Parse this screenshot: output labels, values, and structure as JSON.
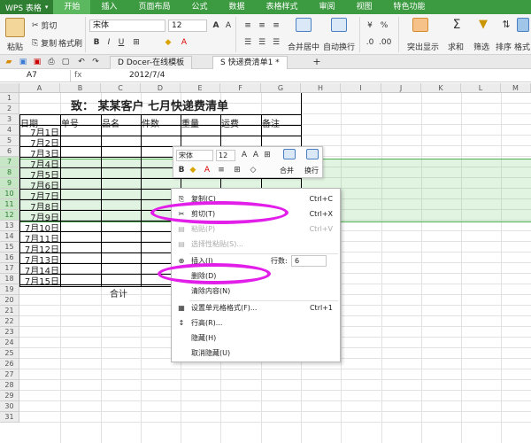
{
  "menubar": {
    "app": "WPS 表格",
    "items": [
      "开始",
      "插入",
      "页面布局",
      "公式",
      "数据",
      "表格样式",
      "审阅",
      "视图",
      "特色功能"
    ]
  },
  "ribbon": {
    "paste": "粘贴",
    "cut": "剪切",
    "copy": "复制",
    "format_painter": "格式刷",
    "font": "宋体",
    "size": "12",
    "merge": "合并居中",
    "wrap": "自动换行",
    "highlight": "突出显示",
    "sum": "求和",
    "filter": "筛选",
    "sort": "排序",
    "format": "格式"
  },
  "tabs": [
    "Docer-在线模板",
    "快递费清单1 *"
  ],
  "formula": {
    "cell": "A7",
    "fx": "fx",
    "value": "2012/7/4"
  },
  "columns": [
    "A",
    "B",
    "C",
    "D",
    "E",
    "F",
    "G",
    "H",
    "I",
    "J",
    "K",
    "L",
    "M"
  ],
  "rows": [
    "1",
    "2",
    "3",
    "4",
    "5",
    "6",
    "7",
    "8",
    "9",
    "10",
    "11",
    "12",
    "13",
    "14",
    "15",
    "16",
    "17",
    "18",
    "19",
    "20",
    "21",
    "22",
    "23",
    "24",
    "25",
    "26",
    "27",
    "28",
    "29",
    "30",
    "31"
  ],
  "sheet": {
    "title": "致：  某某客户   七月快递费清单",
    "headers": [
      "日期",
      "单号",
      "品名",
      "件数",
      "重量",
      "运费",
      "备注"
    ],
    "dates": [
      "7月1日",
      "7月2日",
      "7月3日",
      "7月4日",
      "7月5日",
      "7月6日",
      "7月7日",
      "7月8日",
      "7月9日",
      "7月10日",
      "7月11日",
      "7月12日",
      "7月13日",
      "7月14日",
      "7月15日"
    ],
    "total": "合计"
  },
  "mini_toolbar": {
    "font": "宋体",
    "size": "12",
    "merge": "合并",
    "wrap": "换行"
  },
  "context_menu": {
    "items": [
      {
        "label": "复制(C)",
        "shortcut": "Ctrl+C",
        "disabled": false
      },
      {
        "label": "剪切(T)",
        "shortcut": "Ctrl+X",
        "disabled": false
      },
      {
        "label": "粘贴(P)",
        "shortcut": "Ctrl+V",
        "disabled": true
      },
      {
        "label": "选择性粘贴(S)...",
        "shortcut": "",
        "disabled": true
      },
      {
        "label": "插入(I)",
        "shortcut": "",
        "disabled": false
      },
      {
        "label": "删除(D)",
        "shortcut": "",
        "disabled": false
      },
      {
        "label": "清除内容(N)",
        "shortcut": "",
        "disabled": false
      },
      {
        "label": "设置单元格格式(F)...",
        "shortcut": "Ctrl+1",
        "disabled": false
      },
      {
        "label": "行高(R)...",
        "shortcut": "",
        "disabled": false
      },
      {
        "label": "隐藏(H)",
        "shortcut": "",
        "disabled": false
      },
      {
        "label": "取消隐藏(U)",
        "shortcut": "",
        "disabled": false
      }
    ],
    "row_count_label": "行数:",
    "row_count_value": "6"
  },
  "colors": {
    "accent": "#3c9a40",
    "highlight": "#e21ee9",
    "selection": "#c6e6c6"
  }
}
